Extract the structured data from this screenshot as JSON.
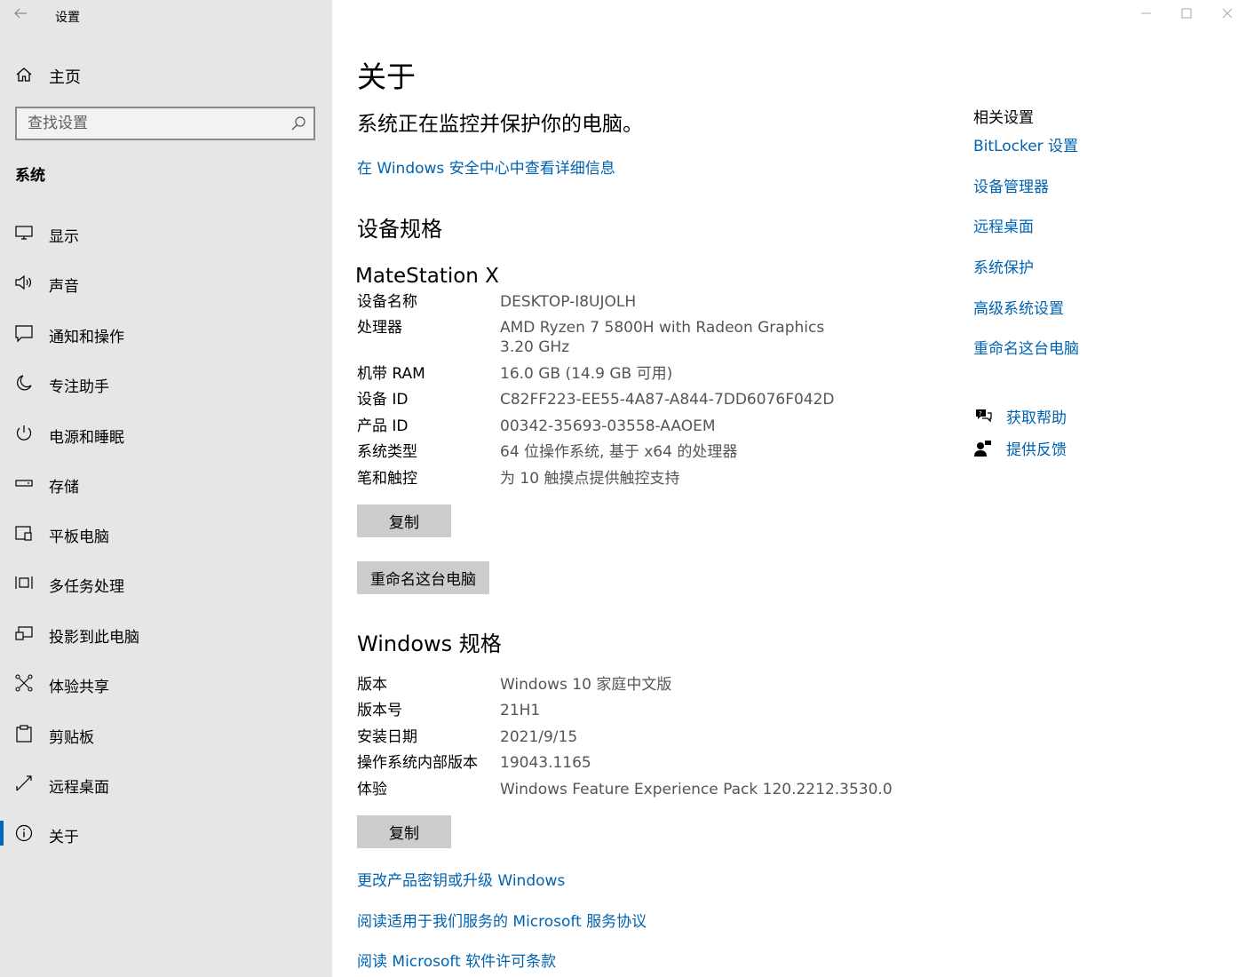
{
  "app": {
    "title": "设置"
  },
  "sidebar": {
    "home_label": "主页",
    "search_placeholder": "查找设置",
    "section_label": "系统",
    "items": [
      {
        "label": "显示",
        "icon": "monitor-icon"
      },
      {
        "label": "声音",
        "icon": "speaker-icon"
      },
      {
        "label": "通知和操作",
        "icon": "notification-icon"
      },
      {
        "label": "专注助手",
        "icon": "moon-icon"
      },
      {
        "label": "电源和睡眠",
        "icon": "power-icon"
      },
      {
        "label": "存储",
        "icon": "storage-icon"
      },
      {
        "label": "平板电脑",
        "icon": "tablet-icon"
      },
      {
        "label": "多任务处理",
        "icon": "multitask-icon"
      },
      {
        "label": "投影到此电脑",
        "icon": "project-icon"
      },
      {
        "label": "体验共享",
        "icon": "share-icon"
      },
      {
        "label": "剪贴板",
        "icon": "clipboard-icon"
      },
      {
        "label": "远程桌面",
        "icon": "remote-desktop-icon"
      },
      {
        "label": "关于",
        "icon": "info-icon",
        "selected": true
      }
    ]
  },
  "main": {
    "title": "关于",
    "protect_text": "系统正在监控并保护你的电脑。",
    "security_link": "在 Windows 安全中心中查看详细信息",
    "device_spec_heading": "设备规格",
    "device_model": "MateStation X",
    "device_specs": [
      {
        "key": "设备名称",
        "value": "DESKTOP-I8UJOLH"
      },
      {
        "key": "处理器",
        "value": "AMD Ryzen 7 5800H with Radeon Graphics",
        "value2": "3.20 GHz"
      },
      {
        "key": "机带 RAM",
        "value": "16.0 GB (14.9 GB 可用)"
      },
      {
        "key": "设备 ID",
        "value": "C82FF223-EE55-4A87-A844-7DD6076F042D"
      },
      {
        "key": "产品 ID",
        "value": "00342-35693-03558-AAOEM"
      },
      {
        "key": "系统类型",
        "value": "64 位操作系统, 基于 x64 的处理器"
      },
      {
        "key": "笔和触控",
        "value": "为 10 触摸点提供触控支持"
      }
    ],
    "copy_label": "复制",
    "rename_label": "重命名这台电脑",
    "windows_spec_heading": "Windows 规格",
    "windows_specs": [
      {
        "key": "版本",
        "value": "Windows 10 家庭中文版"
      },
      {
        "key": "版本号",
        "value": "21H1"
      },
      {
        "key": "安装日期",
        "value": "2021/9/15"
      },
      {
        "key": "操作系统内部版本",
        "value": "19043.1165"
      },
      {
        "key": "体验",
        "value": "Windows Feature Experience Pack 120.2212.3530.0"
      }
    ],
    "windows_copy_label": "复制",
    "bottom_links": [
      "更改产品密钥或升级 Windows",
      "阅读适用于我们服务的 Microsoft 服务协议",
      "阅读 Microsoft 软件许可条款"
    ]
  },
  "related": {
    "title": "相关设置",
    "links": [
      "BitLocker 设置",
      "设备管理器",
      "远程桌面",
      "系统保护",
      "高级系统设置",
      "重命名这台电脑"
    ],
    "help_label": "获取帮助",
    "feedback_label": "提供反馈"
  },
  "colors": {
    "sidebar_bg": "#e6e6e6",
    "link": "#0063b1",
    "accent": "#0067c0",
    "button_bg": "#cccccc"
  }
}
